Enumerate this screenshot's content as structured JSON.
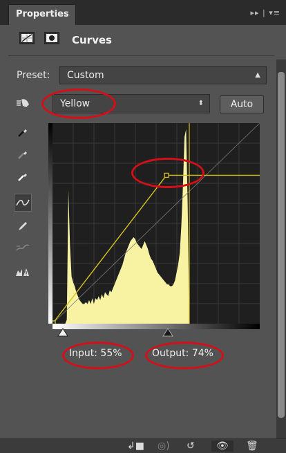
{
  "panel": {
    "tab_title": "Properties",
    "tab_controls": "▸▸ | ▾≡"
  },
  "header": {
    "title": "Curves",
    "adjustment_icon": "curves-adjustment-icon",
    "mask_icon": "mask-icon"
  },
  "preset": {
    "label": "Preset:",
    "value": "Custom"
  },
  "channel": {
    "value": "Yellow"
  },
  "auto_button": {
    "label": "Auto"
  },
  "tools": [
    "on-image-adjust-icon",
    "sample-black-point-icon",
    "sample-gray-point-icon",
    "sample-white-point-icon",
    "curve-point-icon",
    "pencil-draw-icon",
    "smooth-curve-icon",
    "clipping-warning-icon"
  ],
  "readout": {
    "input_label": "Input:",
    "input_value": "55%",
    "output_label": "Output:",
    "output_value": "74%"
  },
  "curve_point": {
    "input": 55,
    "output": 74
  },
  "colors": {
    "panel_bg": "#535353",
    "graph_bg": "#1f1f1f",
    "histogram": "#f7f3a3",
    "curve": "#d6c21e",
    "annotation": "#d40f18"
  },
  "bottom_icons": [
    "clip-to-layer-icon",
    "toggle-visibility-preview-icon",
    "reset-icon",
    "eye-icon",
    "trash-icon"
  ]
}
